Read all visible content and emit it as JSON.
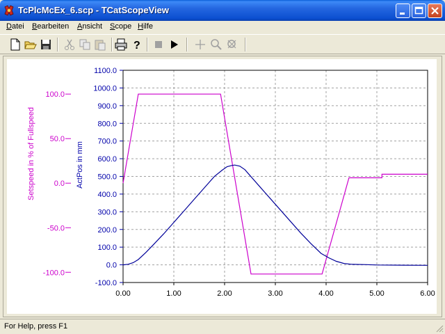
{
  "window": {
    "title": "TcPlcMcEx_6.scp - TCatScopeView",
    "controls": [
      "minimize",
      "maximize",
      "close"
    ]
  },
  "menu": {
    "items": [
      {
        "label": "Datei",
        "mnemonic": "D"
      },
      {
        "label": "Bearbeiten",
        "mnemonic": "B"
      },
      {
        "label": "Ansicht",
        "mnemonic": "A"
      },
      {
        "label": "Scope",
        "mnemonic": "S"
      },
      {
        "label": "Hilfe",
        "mnemonic": "H"
      }
    ]
  },
  "toolbar": {
    "buttons": [
      {
        "icon": "new-file-icon",
        "enabled": true
      },
      {
        "icon": "open-folder-icon",
        "enabled": true
      },
      {
        "icon": "save-icon",
        "enabled": true
      },
      {
        "icon": "cut-icon",
        "enabled": false
      },
      {
        "icon": "copy-icon",
        "enabled": false
      },
      {
        "icon": "paste-icon",
        "enabled": false
      },
      {
        "icon": "print-icon",
        "enabled": true
      },
      {
        "icon": "help-icon",
        "enabled": true
      },
      {
        "icon": "stop-icon",
        "enabled": false
      },
      {
        "icon": "play-icon",
        "enabled": true
      },
      {
        "icon": "crosshair-icon",
        "enabled": false
      },
      {
        "icon": "zoom-icon",
        "enabled": false
      },
      {
        "icon": "zoom-reset-icon",
        "enabled": false
      }
    ]
  },
  "chart_data": {
    "type": "line",
    "x_ticks": [
      "0.00",
      "1.00",
      "2.00",
      "3.00",
      "4.00",
      "5.00",
      "6.00"
    ],
    "xlim": [
      0,
      6
    ],
    "grid": true,
    "axes": [
      {
        "label": "Setspeed in % of Fullspeed",
        "color": "#cc00cc",
        "ticks": [
          "100.0",
          "50.0",
          "0.0",
          "-50.0",
          "-100.0"
        ],
        "tick_values": [
          100,
          50,
          0,
          -50,
          -100
        ],
        "ylim": [
          -111.5,
          126.7
        ]
      },
      {
        "label": "ActPos in mm",
        "color": "#0000aa",
        "ticks": [
          "1100.0",
          "1000.0",
          "900.0",
          "800.0",
          "700.0",
          "600.0",
          "500.0",
          "400.0",
          "300.0",
          "200.0",
          "100.0",
          "0.0",
          "-100.0"
        ],
        "tick_values": [
          1100,
          1000,
          900,
          800,
          700,
          600,
          500,
          400,
          300,
          200,
          100,
          0,
          -100
        ],
        "ylim": [
          -100,
          1100
        ]
      }
    ],
    "series": [
      {
        "axis": 0,
        "color": "#cc00cc",
        "points": [
          [
            0,
            0
          ],
          [
            0.3,
            100
          ],
          [
            1.92,
            100
          ],
          [
            2.52,
            -102
          ],
          [
            3.92,
            -102
          ],
          [
            4.45,
            6
          ],
          [
            5.1,
            6
          ],
          [
            5.1,
            10
          ],
          [
            6.0,
            10
          ]
        ]
      },
      {
        "axis": 1,
        "color": "#000099",
        "points": [
          [
            0,
            0
          ],
          [
            0.1,
            3
          ],
          [
            0.2,
            12
          ],
          [
            0.3,
            30
          ],
          [
            0.45,
            70
          ],
          [
            0.6,
            115
          ],
          [
            0.8,
            175
          ],
          [
            1.0,
            240
          ],
          [
            1.2,
            305
          ],
          [
            1.4,
            370
          ],
          [
            1.6,
            435
          ],
          [
            1.8,
            500
          ],
          [
            1.95,
            535
          ],
          [
            2.05,
            555
          ],
          [
            2.15,
            562
          ],
          [
            2.2,
            564
          ],
          [
            2.3,
            558
          ],
          [
            2.4,
            538
          ],
          [
            2.5,
            505
          ],
          [
            2.7,
            440
          ],
          [
            2.9,
            375
          ],
          [
            3.1,
            310
          ],
          [
            3.3,
            245
          ],
          [
            3.5,
            180
          ],
          [
            3.7,
            120
          ],
          [
            3.9,
            65
          ],
          [
            4.05,
            40
          ],
          [
            4.2,
            20
          ],
          [
            4.35,
            8
          ],
          [
            4.5,
            3
          ],
          [
            4.8,
            1
          ],
          [
            5.0,
            -1
          ],
          [
            5.5,
            -2
          ],
          [
            6.0,
            -3
          ]
        ]
      }
    ]
  },
  "status": {
    "text": "For Help, press F1"
  }
}
